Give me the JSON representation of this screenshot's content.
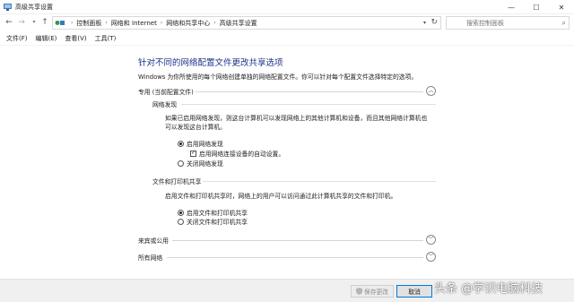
{
  "window": {
    "title": "高级共享设置",
    "min_glyph": "—",
    "max_glyph": "☐",
    "close_glyph": "✕"
  },
  "address": {
    "crumbs": [
      "控制面板",
      "网络和 Internet",
      "网络和共享中心",
      "高级共享设置"
    ],
    "search_placeholder": "搜索控制面板"
  },
  "menu": [
    "文件(F)",
    "编辑(E)",
    "查看(V)",
    "工具(T)"
  ],
  "page": {
    "heading": "针对不同的网络配置文件更改共享选项",
    "description": "Windows 为你所使用的每个网络创建单独的网络配置文件。你可以针对每个配置文件选择特定的选项。"
  },
  "private_profile": {
    "label": "专用 (当前配置文件)",
    "network_discovery": {
      "title": "网络发现",
      "description_line1": "如果已启用网络发现，则这台计算机可以发现网络上的其他计算机和设备，而且其他网络计算机也",
      "description_line2": "可以发现这台计算机。",
      "enable_label": "启用网络发现",
      "auto_setup_label": "启用网络连接设备的自动设置。",
      "disable_label": "关闭网络发现",
      "enabled": true,
      "auto_setup_checked": true
    },
    "file_printer_sharing": {
      "title": "文件和打印机共享",
      "description": "启用文件和打印机共享时，网络上的用户可以访问通过此计算机共享的文件和打印机。",
      "enable_label": "启用文件和打印机共享",
      "disable_label": "关闭文件和打印机共享",
      "enabled": true
    }
  },
  "guest_profile": {
    "label": "来宾或公用"
  },
  "all_networks": {
    "label": "所有网络"
  },
  "footer": {
    "save_label": "保存更改",
    "cancel_label": "取消"
  },
  "watermark": "头条 @学识电脑科技",
  "colors": {
    "heading": "#1e3287",
    "accent": "#0078d7"
  },
  "icons": {
    "back": "←",
    "forward": "→",
    "up": "↑",
    "refresh": "↻",
    "search": "⌕",
    "chevron_up": "︿",
    "chevron_down": "﹀"
  }
}
